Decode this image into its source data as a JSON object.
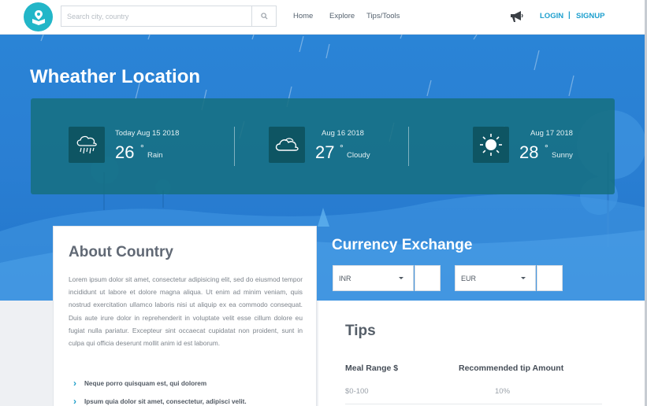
{
  "header": {
    "search_placeholder": "Search city, country",
    "nav": [
      "Home",
      "Explore",
      "Tips/Tools"
    ],
    "login_label": "LOGIN",
    "separator": "|",
    "signup_label": "SIGNUP",
    "icons": {
      "logo": "map-book-icon",
      "search": "search-icon",
      "announce": "megaphone-icon"
    }
  },
  "hero": {
    "title": "Wheather Location",
    "weather": [
      {
        "date": "Today Aug 15 2018",
        "temp": "26",
        "degree": "°",
        "condition": "Rain",
        "icon": "rain-cloud-icon"
      },
      {
        "date": "Aug 16 2018",
        "temp": "27",
        "degree": "°",
        "condition": "Cloudy",
        "icon": "cloud-icon"
      },
      {
        "date": "Aug 17 2018",
        "temp": "28",
        "degree": "°",
        "condition": "Sunny",
        "icon": "sun-icon"
      }
    ]
  },
  "about": {
    "title": "About Country",
    "text": "Lorem ipsum dolor sit amet, consectetur adipisicing elit, sed do eiusmod tempor incididunt ut labore et dolore magna aliqua. Ut enim ad minim veniam, quis nostrud exercitation ullamco laboris nisi ut aliquip ex ea commodo consequat. Duis aute irure dolor in reprehenderit in voluptate velit esse cillum dolore eu fugiat nulla pariatur. Excepteur sint occaecat cupidatat non proident, sunt in culpa qui officia deserunt mollit anim id est laborum.",
    "items": [
      "Neque porro quisquam est, qui dolorem",
      "Ipsum quia dolor sit amet, consectetur, adipisci velit."
    ]
  },
  "currency": {
    "title": "Currency Exchange",
    "from": "INR",
    "to": "EUR"
  },
  "tips": {
    "title": "Tips",
    "columns": [
      "Meal Range $",
      "Recommended tip Amount"
    ],
    "rows": [
      {
        "range": "$0-100",
        "tip": "10%"
      }
    ]
  },
  "colors": {
    "accent": "#22b6c8",
    "link": "#1d9fce",
    "hero_blue": "#2a7fd3",
    "weather_panel": "#167082"
  }
}
